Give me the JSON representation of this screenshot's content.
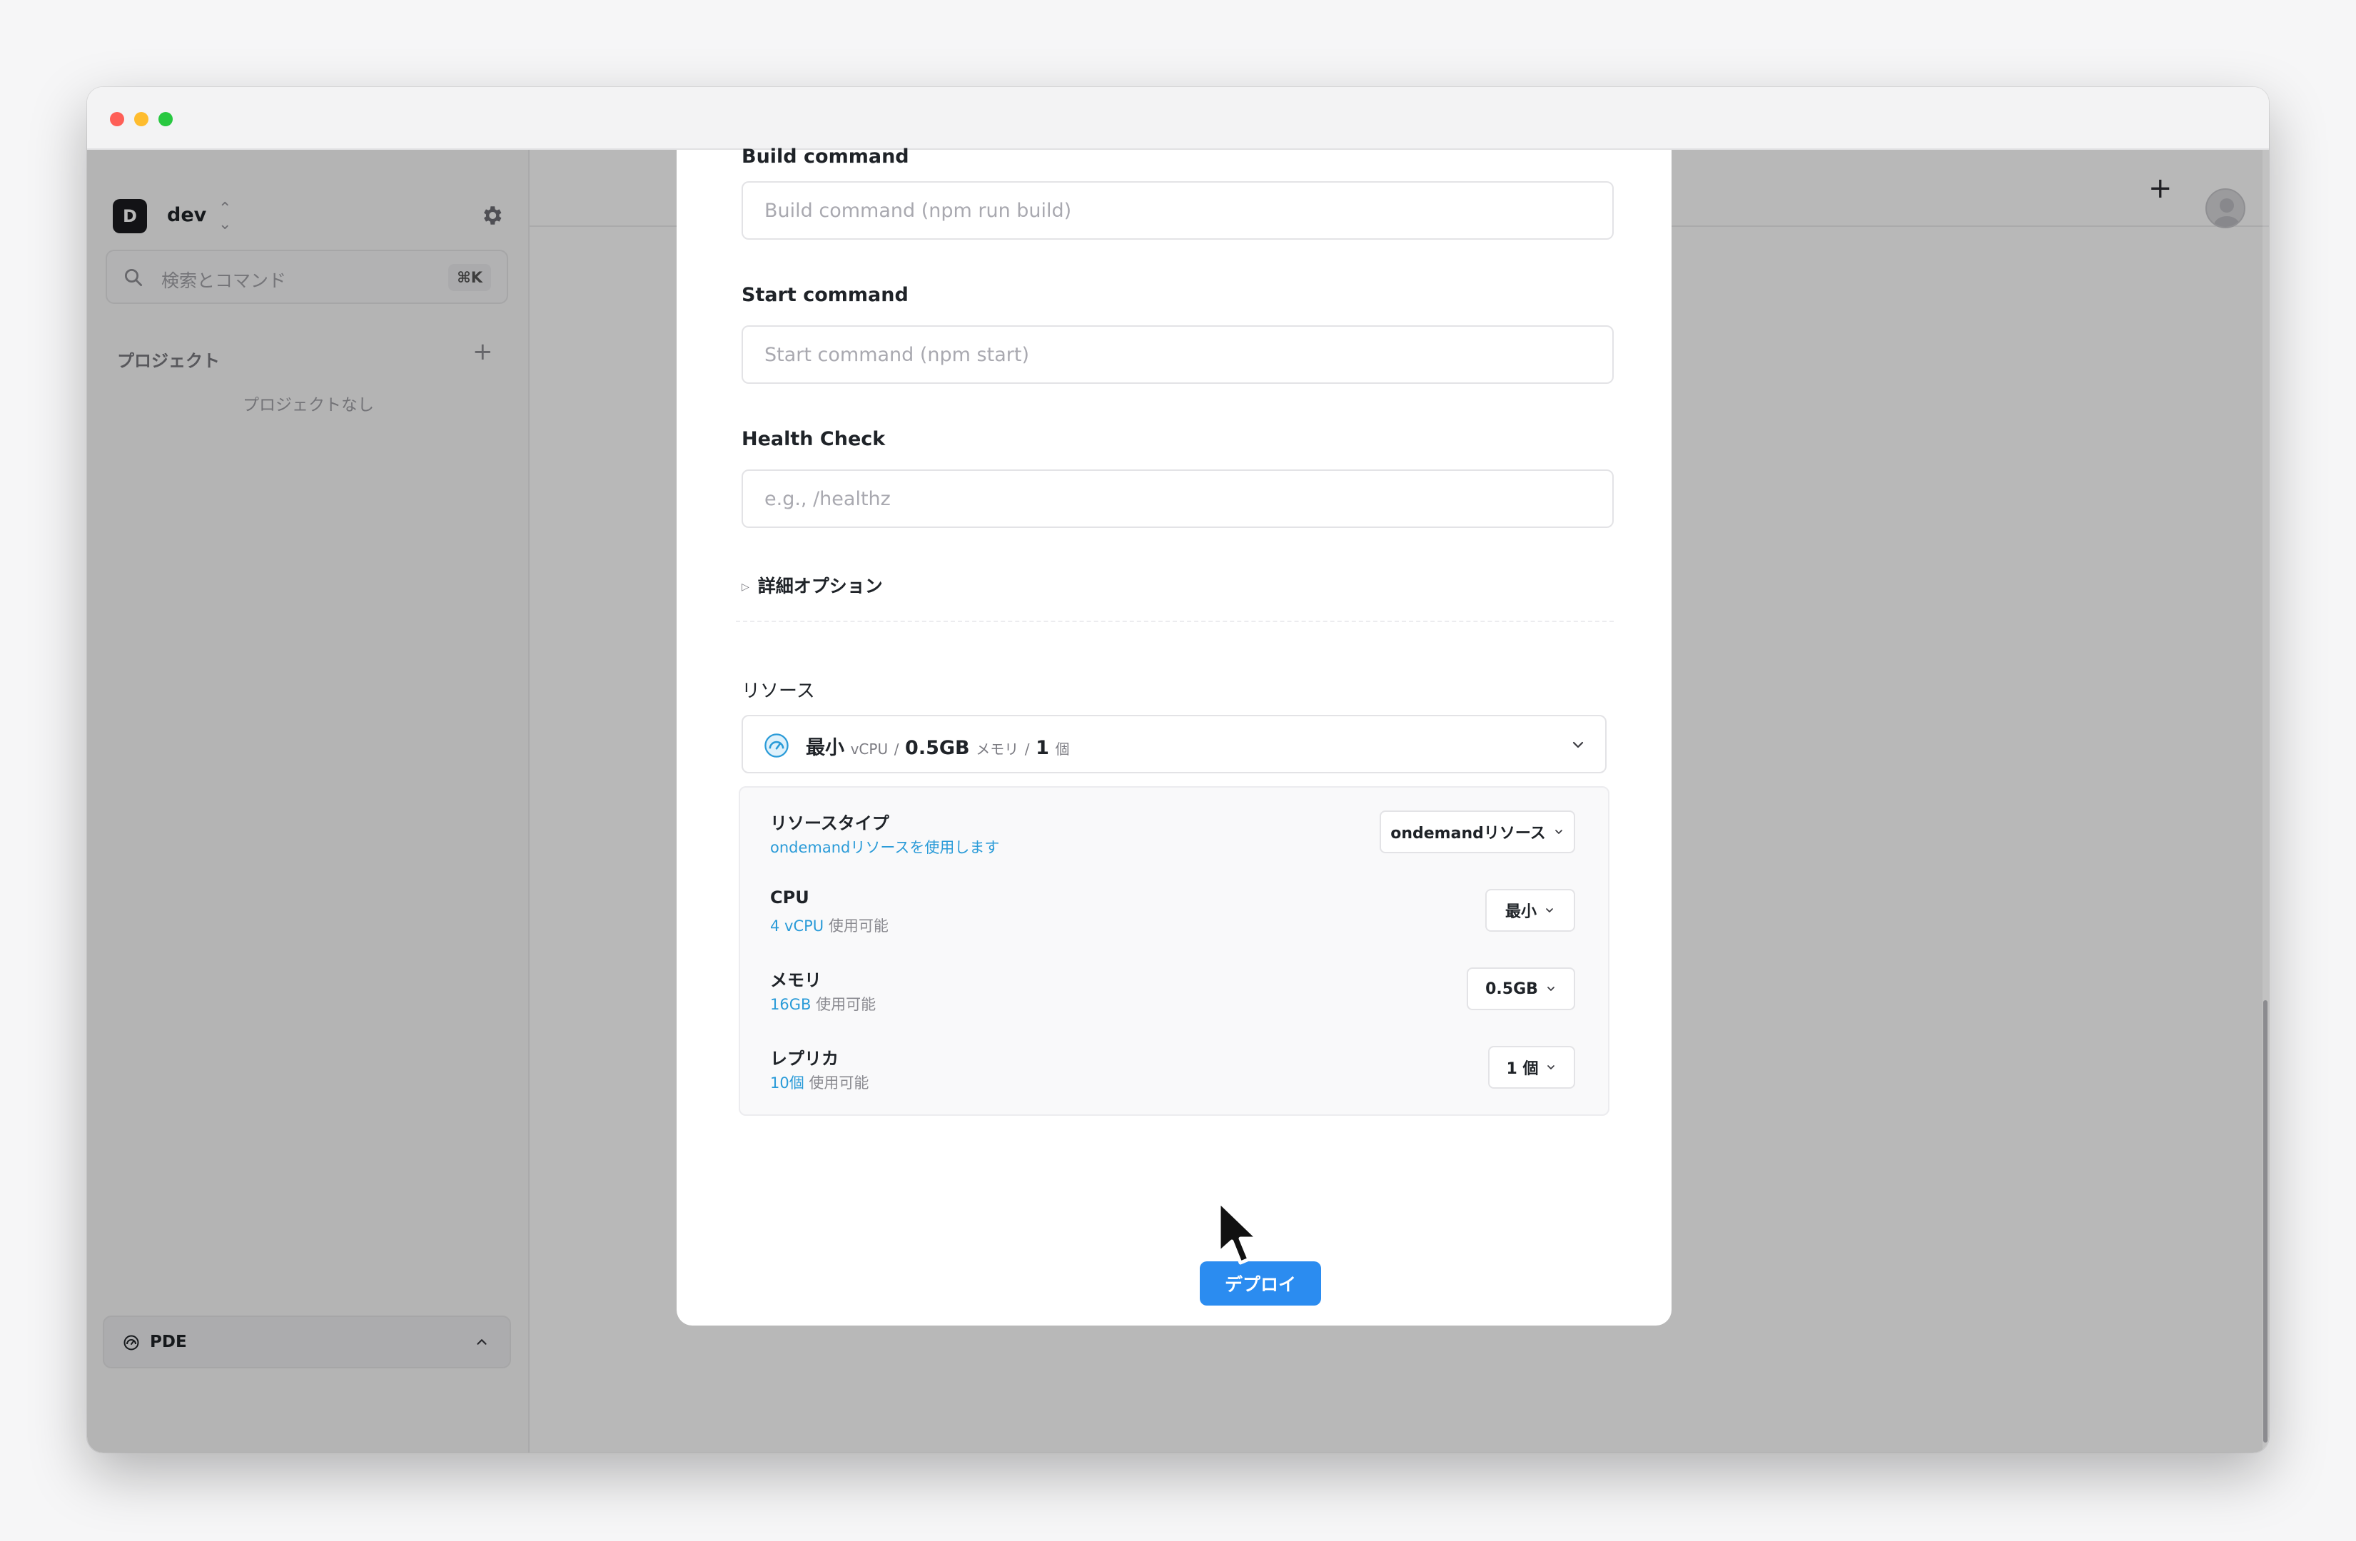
{
  "window": {
    "traffic_lights": [
      "close",
      "minimize",
      "zoom"
    ]
  },
  "sidebar": {
    "workspace_initial": "D",
    "workspace_name": "dev",
    "search_placeholder": "検索とコマンド",
    "search_shortcut": "⌘K",
    "projects_heading": "プロジェクト",
    "projects_empty": "プロジェクトなし",
    "footer_label": "PDE"
  },
  "modal": {
    "build_label": "Build command",
    "build_placeholder": "Build command (npm run build)",
    "start_label": "Start command",
    "start_placeholder": "Start command (npm start)",
    "health_label": "Health Check",
    "health_placeholder": "e.g., /healthz",
    "advanced_label": "詳細オプション",
    "resources_label": "リソース",
    "resource_summary": {
      "cpu": "最小",
      "cpu_unit": "vCPU",
      "sep1": "/",
      "memory": "0.5GB",
      "memory_unit": "メモリ",
      "sep2": "/",
      "replicas": "1",
      "replicas_unit": "個"
    },
    "rows": [
      {
        "title": "リソースタイプ",
        "sub_full": "ondemandリソースを使用します",
        "value": "ondemandリソース"
      },
      {
        "title": "CPU",
        "sub_highlight": "4 vCPU",
        "sub_rest": "使用可能",
        "value": "最小"
      },
      {
        "title": "メモリ",
        "sub_highlight": "16GB",
        "sub_rest": "使用可能",
        "value": "0.5GB"
      },
      {
        "title": "レプリカ",
        "sub_highlight": "10個",
        "sub_rest": "使用可能",
        "value": "1 個"
      }
    ],
    "deploy_label": "デプロイ"
  },
  "colors": {
    "accent": "#2b8cf0",
    "link": "#2a9bd8",
    "overlay": "rgba(0,0,0,0.28)"
  },
  "icons": [
    "settings-icon",
    "search-icon",
    "plus-icon",
    "chevron-down-icon",
    "chevron-up-icon",
    "gauge-icon",
    "avatar-icon",
    "cursor-icon",
    "triangle-right-icon"
  ]
}
